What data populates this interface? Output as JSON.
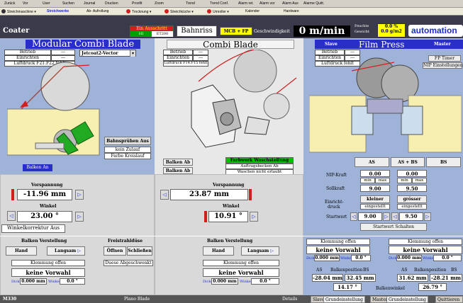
{
  "menubar": [
    "Zurück",
    "Vor",
    "User",
    "Suchen",
    "Journal",
    "Drucken",
    "Proofit",
    "Zoom",
    "Trend",
    "Trend Conf.",
    "Alarm ret.",
    "Alarm vor",
    "Alarm Aus",
    "Alarme Quitt."
  ],
  "toolbar": [
    "Streichmaschine",
    "Streichwerke",
    "Ab- Aufrollung",
    "Trocknung",
    "Streichküche",
    "Umroller",
    "Kalender",
    "Hardware"
  ],
  "header": {
    "title": "Coater",
    "warn1": "Ein Ausschritt",
    "warn1_a": "HI",
    "warn1_b": "ET200",
    "bahnriss": "Bahnriss",
    "mcb": "MCB + FP",
    "geschw_label": "Geschwindigkeit",
    "speed": "0 m/min",
    "feuchte_label": "Feuchte",
    "gewicht_label": "Gewicht",
    "feuchte_val": "0.0 %",
    "gewicht_val": "0.0 g/m2",
    "logo": "automation"
  },
  "left": {
    "title": "Modular Combi Blade",
    "betrieb": "Betrieb",
    "einrichten": "Einrichten",
    "dash": "---",
    "luftdruck": "Luftdruck F21.F22 fehlt",
    "product": "Jetcoat2-Vector",
    "spruehen": "Bahnsprühen Aus",
    "zulauf": "kein Zulauf",
    "farbe": "Farbe Kreislauf",
    "balken_an": "Balken An",
    "vorspannung": "Vorspannung",
    "vorspannung_val": "-11.96 mm",
    "winkel": "Winkel",
    "winkel_val": "23.00 °",
    "winkelkorrektur": "Winkelkorrektur Aus",
    "balken_verst": "Balken Verstellung",
    "hand": "Hand",
    "langsam": "Langsam",
    "klemmung": "Klemmung offen",
    "keine_vorwahl": "keine Vorwahl",
    "dicke": "Dicke",
    "dicke_val": "0.000 mm",
    "winkel_lbl": "Winkel",
    "winkel_small": "0.0 °",
    "freistrahl": "Freistrahldüse",
    "oeffnen": "Öffnen",
    "schliessen": "Schließen",
    "duese": "Duese Abgeschwenkt"
  },
  "mid": {
    "title": "Combi Blade",
    "betrieb": "Betrieb",
    "einrichten": "Einrichten",
    "dash": "---",
    "luftdruck": "Luftdruck F14.F15 fehlt",
    "balken_ab1": "Balken Ab",
    "balken_ab2": "Balken Ab",
    "farbwerk": "Farbwerk Waschstellung",
    "auftrag": "Auftragsbecken Ab",
    "waschen": "Waschen nicht erlaubt",
    "vorspannung": "Vorspannung",
    "vorspannung_val": "23.87 mm",
    "winkel": "Winkel",
    "winkel_val": "10.91 °",
    "balken_verst": "Balken Verstellung",
    "hand": "Hand",
    "langsam": "Langsam",
    "klemmung": "Klemmung offen",
    "keine_vorwahl": "keine Vorwahl",
    "dicke": "Dicke",
    "dicke_val": "0.000 mm",
    "winkel_lbl": "Winkel",
    "winkel_small": "0.0 °"
  },
  "right": {
    "slave": "Slave",
    "title": "Film Press",
    "master": "Master",
    "betrieb": "Betrieb",
    "einrichten": "Einrichten",
    "dash": "---",
    "luftdruck": "Luftdruck fehlt",
    "fp_timer": "FP Timer",
    "nip_einst": "NIP Einstellungen",
    "as": "AS",
    "asbs": "AS + BS",
    "bs": "BS",
    "nip_kraft": "NIP-Kraft",
    "nip_as": "0.00",
    "nip_bs": "0.00",
    "min": "min",
    "max": "max",
    "sollkraft": "Sollkraft",
    "soll_as": "9.00",
    "soll_bs": "9.50",
    "einricht": "Einricht-",
    "druck": "druck",
    "kleiner": "kleiner",
    "groesser": "grösser",
    "eingestellt": "eingestellt",
    "startwert": "Startwert",
    "start_as": "9.00",
    "start_bs": "9.50",
    "startwert_schalten": "Startwert Schalten",
    "klemmung": "Klemmung offen",
    "keine_vorwahl": "keine Vorwahl",
    "dicke": "Dicke",
    "dicke_val": "0.000 mm",
    "winkel_lbl": "Winkel",
    "winkel_small": "0.0 °",
    "bs_lbl": "BS",
    "balkenposition": "Balkenposition",
    "l_pos1": "-28.04 mm",
    "l_pos2": "32.45 mm",
    "l_winkel": "14.17 °",
    "r_pos1": "31.62 mm",
    "r_pos2": "-28.21 mm",
    "r_winkel": "26.79 °",
    "balkenwinkel": "Balkenwinkel"
  },
  "status": {
    "left": "M330",
    "center": "Plano Blade",
    "details": "Details",
    "tabs": [
      "Slave",
      "Grundeinstellung",
      "Master",
      "Grundeinstellung",
      "Quittieren"
    ]
  },
  "colors": {
    "title_blue": "#2a2ec8",
    "panel_blue": "#9fb3d9",
    "red": "#d21e1e",
    "green": "#00c000",
    "yellow": "#ffff00"
  }
}
